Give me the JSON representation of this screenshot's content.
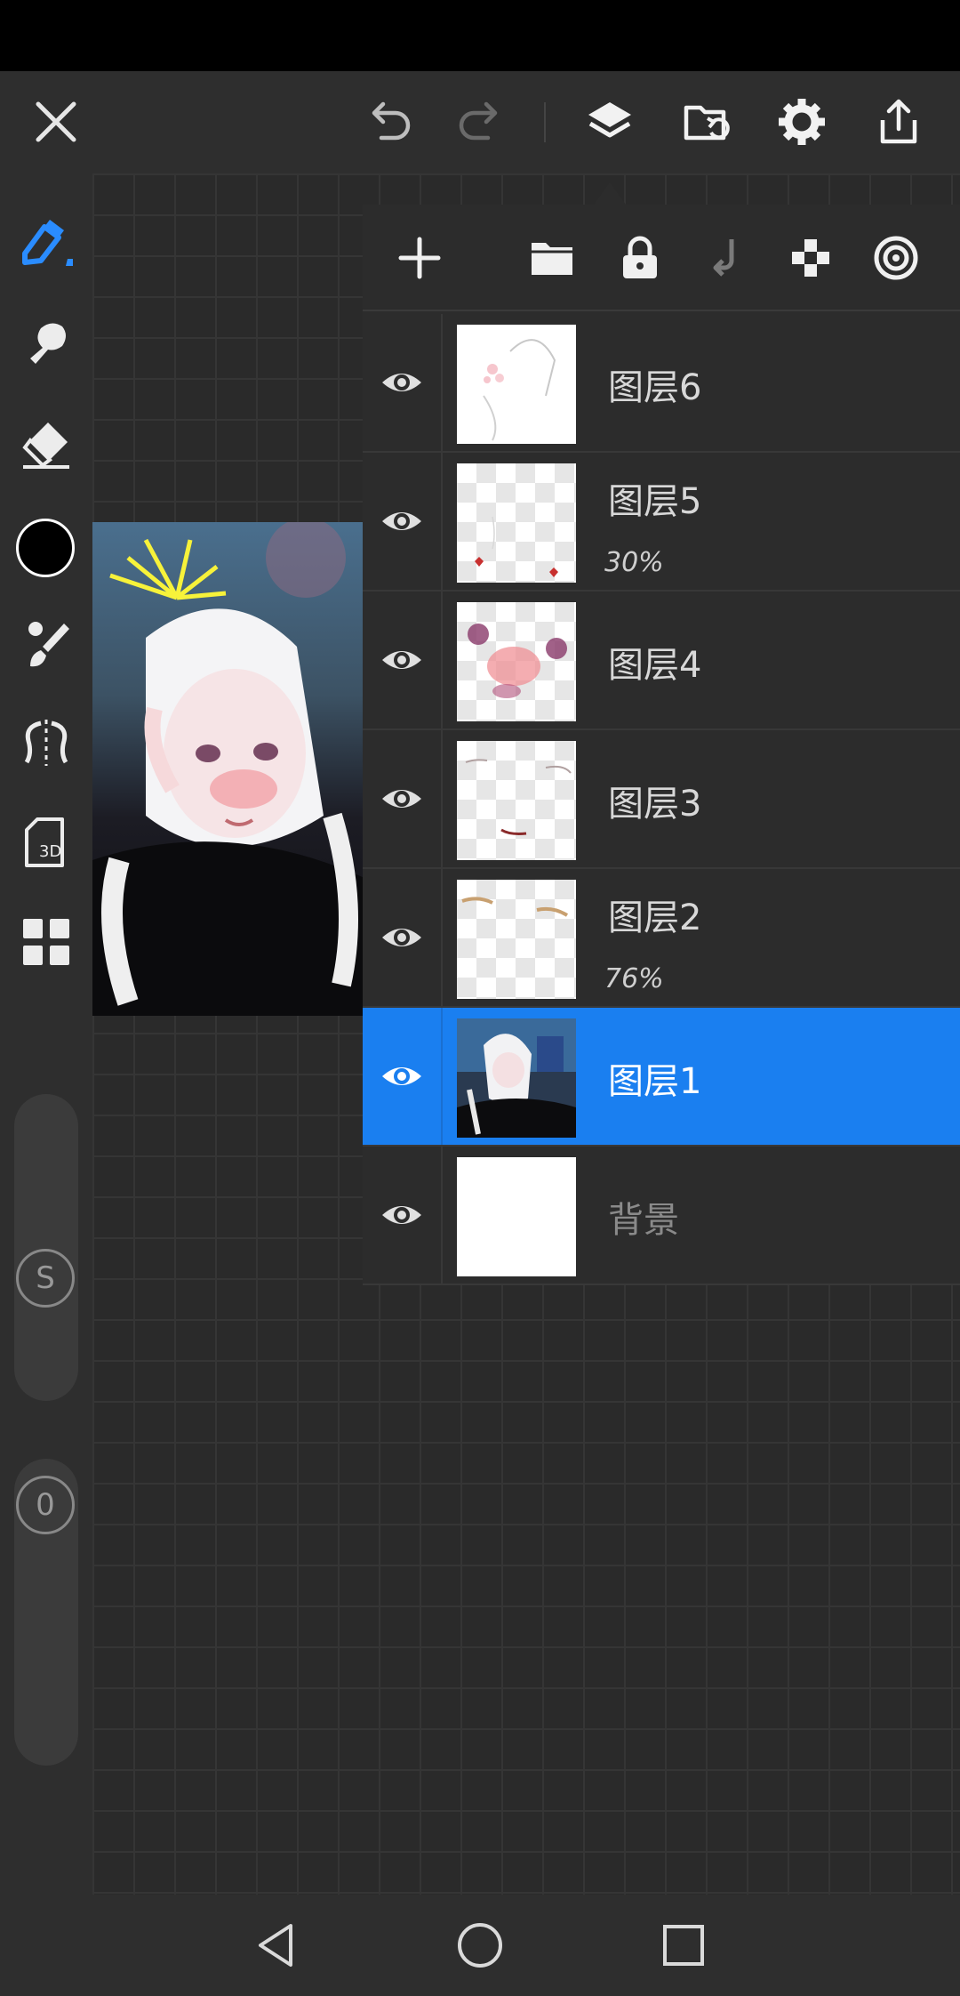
{
  "top_toolbar": {
    "icons": [
      "close-icon",
      "undo-icon",
      "redo-icon",
      "layers-icon",
      "import-folder-icon",
      "gear-icon",
      "share-icon"
    ]
  },
  "left_toolbar": {
    "icons": [
      "pen-icon",
      "smudge-icon",
      "eraser-icon",
      "color-swatch",
      "brush-settings-icon",
      "symmetry-icon",
      "3d-icon",
      "grid-icon"
    ],
    "current_color": "#000000",
    "size_slider_label": "S",
    "opacity_slider_label": "0"
  },
  "layers_panel": {
    "toolbar_icons": [
      "add-icon",
      "folder-icon",
      "lock-icon",
      "merge-down-icon",
      "transparency-icon",
      "target-icon"
    ],
    "layers": [
      {
        "name": "图层6",
        "opacity": ""
      },
      {
        "name": "图层5",
        "opacity": "30%"
      },
      {
        "name": "图层4",
        "opacity": ""
      },
      {
        "name": "图层3",
        "opacity": ""
      },
      {
        "name": "图层2",
        "opacity": "76%"
      },
      {
        "name": "图层1",
        "opacity": ""
      },
      {
        "name": "背景",
        "opacity": ""
      }
    ],
    "selected_layer": "图层1",
    "accent_color": "#1a7ff0"
  },
  "nav_bar": {
    "icons": [
      "back-icon",
      "home-icon",
      "recents-icon"
    ]
  }
}
